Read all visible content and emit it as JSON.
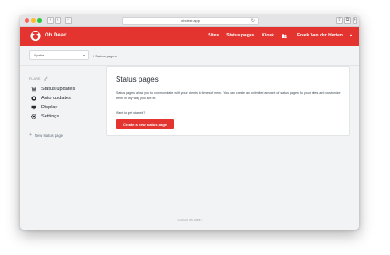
{
  "browser": {
    "url": "ohdear.app",
    "back_glyph": "‹",
    "forward_glyph": "›",
    "sidebar_glyph": "▫",
    "reload_glyph": "↻",
    "share_glyph": "⇧",
    "tabs_glyph": "⧉",
    "more_glyph": "+"
  },
  "app": {
    "brand": "Oh Dear!",
    "nav": [
      "Sites",
      "Status pages",
      "Kiosk"
    ],
    "user": "Freek Van der Herten",
    "user_caret": "▾",
    "brand_color": "#e3342f"
  },
  "subbar": {
    "site_select_value": "Spatie",
    "site_select_arrow": "▾",
    "breadcrumb": "/ Status pages"
  },
  "sidebar": {
    "heading": "FLARE",
    "items": [
      {
        "label": "Status updates",
        "icon": "status-updates-icon"
      },
      {
        "label": "Auto updates",
        "icon": "auto-updates-icon"
      },
      {
        "label": "Display",
        "icon": "display-icon"
      },
      {
        "label": "Settings",
        "icon": "settings-icon"
      }
    ],
    "new_page_plus": "+",
    "new_page": "New status page"
  },
  "main": {
    "title": "Status pages",
    "description": "Status pages allow you to communicate with your clients in times of need. You can create an unlimited amount of status pages for your sites and customize them in any way you see fit.",
    "prompt": "Want to get started?",
    "cta": "Create a new status page"
  },
  "footer": {
    "text": "© 2020 Oh Dear!"
  }
}
